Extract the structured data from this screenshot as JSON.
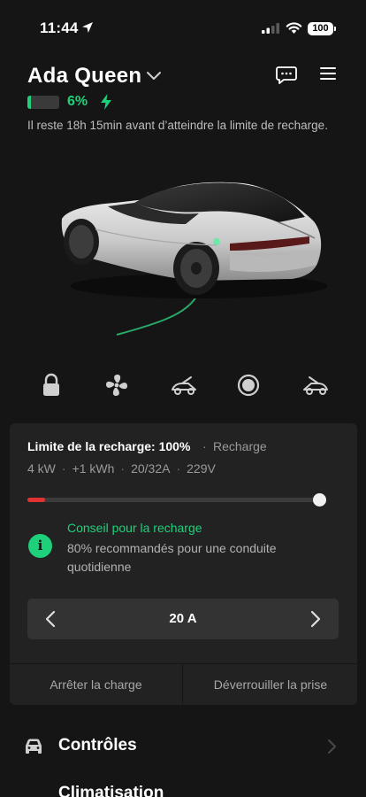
{
  "status_bar": {
    "time": "11:44",
    "battery": "100"
  },
  "header": {
    "vehicle_name": "Ada Queen",
    "battery_percent": "6%",
    "battery_level": 0.06,
    "charge_info": "Il reste 18h 15min avant d’atteindre la limite de recharge."
  },
  "quick_controls": [
    {
      "icon": "lock-icon"
    },
    {
      "icon": "fan-icon"
    },
    {
      "icon": "frunk-icon"
    },
    {
      "icon": "record-icon"
    },
    {
      "icon": "trunk-icon"
    }
  ],
  "charging": {
    "limit_label": "Limite de la recharge: 100%",
    "separator": "·",
    "status": "Recharge",
    "stats": [
      "4 kW",
      "+1 kWh",
      "20/32A",
      "229V"
    ],
    "limit_level": 1.0,
    "current_level": 0.06,
    "tip_title": "Conseil pour la recharge",
    "tip_text": "80% recommandés pour une conduite quotidienne",
    "amps": "20 A",
    "stop_label": "Arrêter la charge",
    "unlock_label": "Déverrouiller la prise"
  },
  "menu": {
    "controls_label": "Contrôles",
    "climate_label": "Climatisation"
  },
  "colors": {
    "accent_green": "#1fd07a",
    "limit_red": "#e03232",
    "background": "#151515",
    "card": "#222222"
  }
}
